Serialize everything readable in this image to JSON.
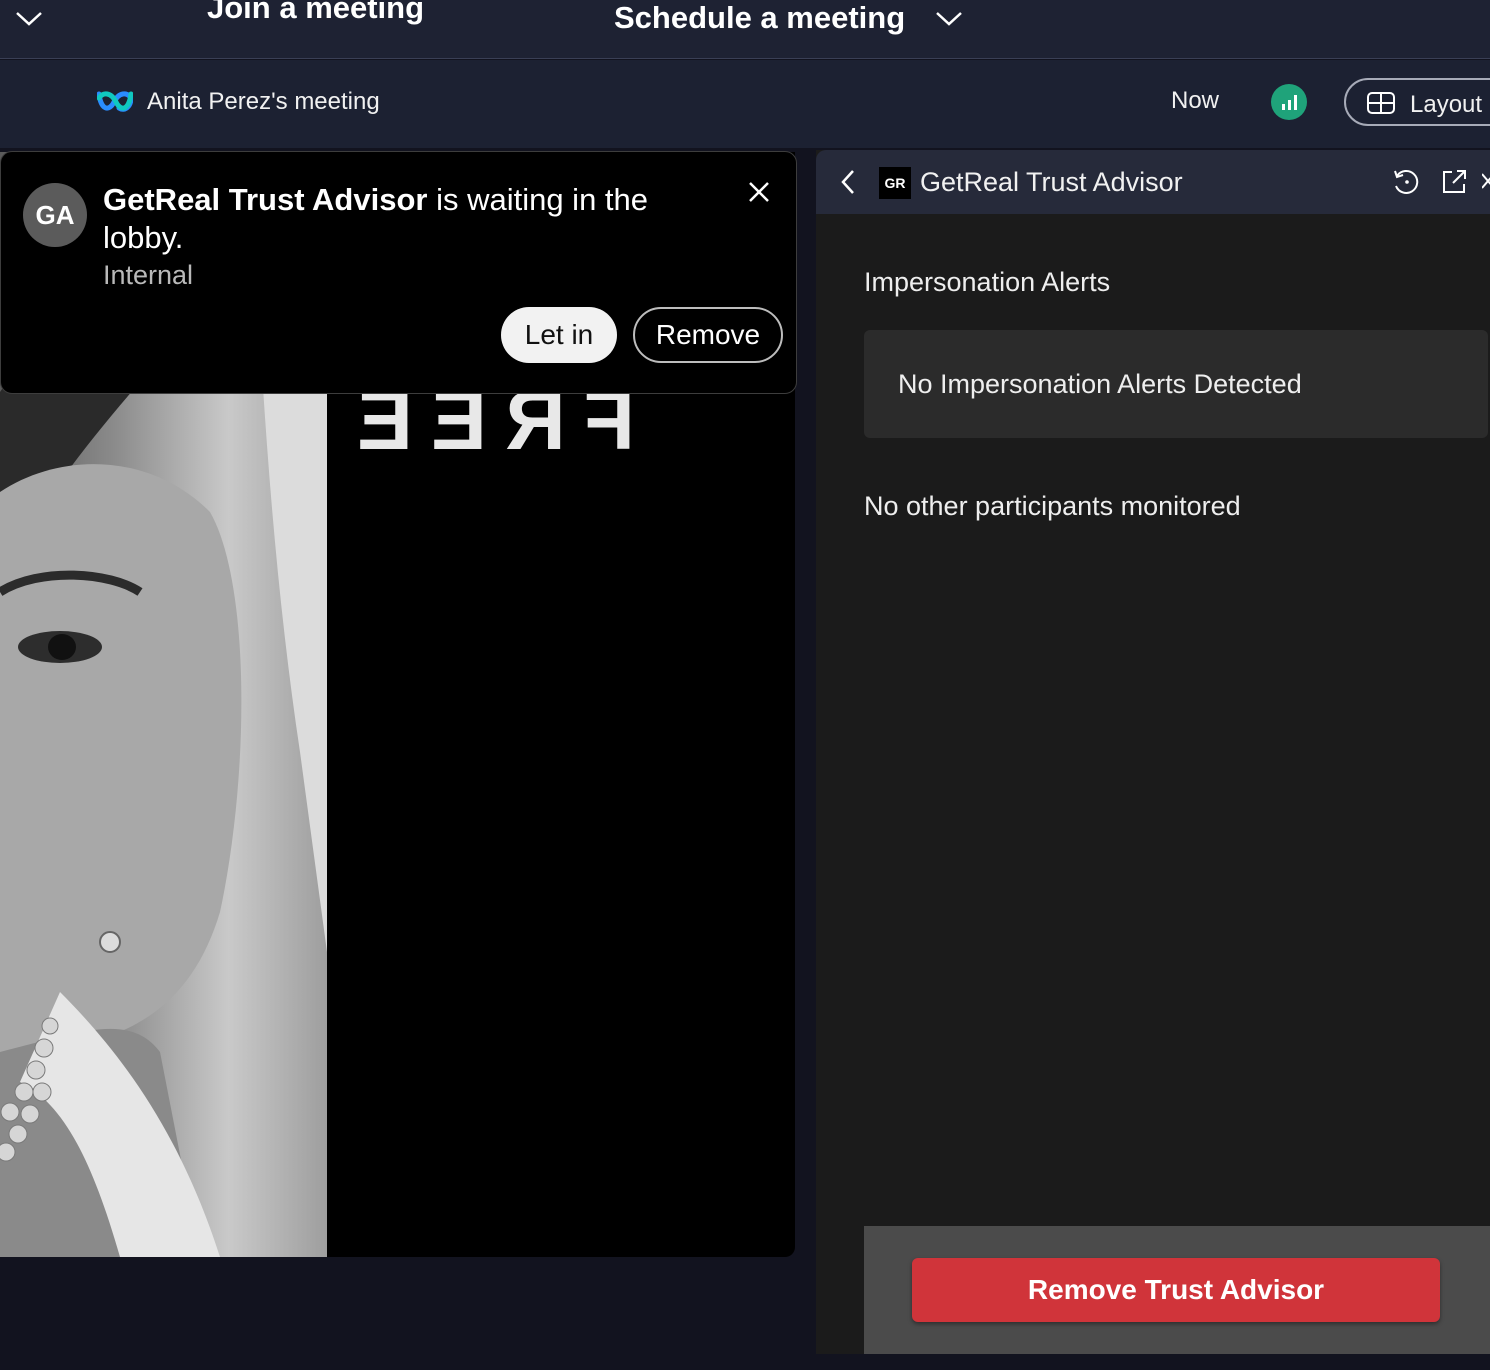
{
  "top_bar": {
    "join_title": "Join a meeting",
    "schedule_title": "Schedule a meeting"
  },
  "meeting_header": {
    "title": "Anita Perez's meeting",
    "time_label": "Now",
    "layout_label": "Layout"
  },
  "video": {
    "mirrored_text": "FREE"
  },
  "lobby_notification": {
    "avatar_initials": "GA",
    "participant_name": "GetReal Trust Advisor",
    "message_suffix": " is waiting in the lobby.",
    "subtitle": "Internal",
    "let_in_label": "Let in",
    "remove_label": "Remove"
  },
  "side_panel": {
    "app_logo_text": "GR",
    "title": "GetReal Trust Advisor",
    "section_heading": "Impersonation Alerts",
    "alerts_status": "No Impersonation Alerts Detected",
    "participants_status": "No other participants monitored",
    "remove_button_label": "Remove Trust Advisor"
  },
  "colors": {
    "app_background": "#12131f",
    "header_background": "#1c2132",
    "panel_background": "#1b1b1b",
    "danger_button": "#d0343a",
    "signal_indicator": "#1fa37a"
  },
  "icons": {
    "top_chevron": "chevron-down-icon",
    "webex": "webex-logo-icon",
    "signal": "signal-strength-icon",
    "layout": "layout-grid-icon",
    "close": "close-icon",
    "back": "chevron-left-icon",
    "refresh": "refresh-icon",
    "popout": "popout-icon"
  }
}
